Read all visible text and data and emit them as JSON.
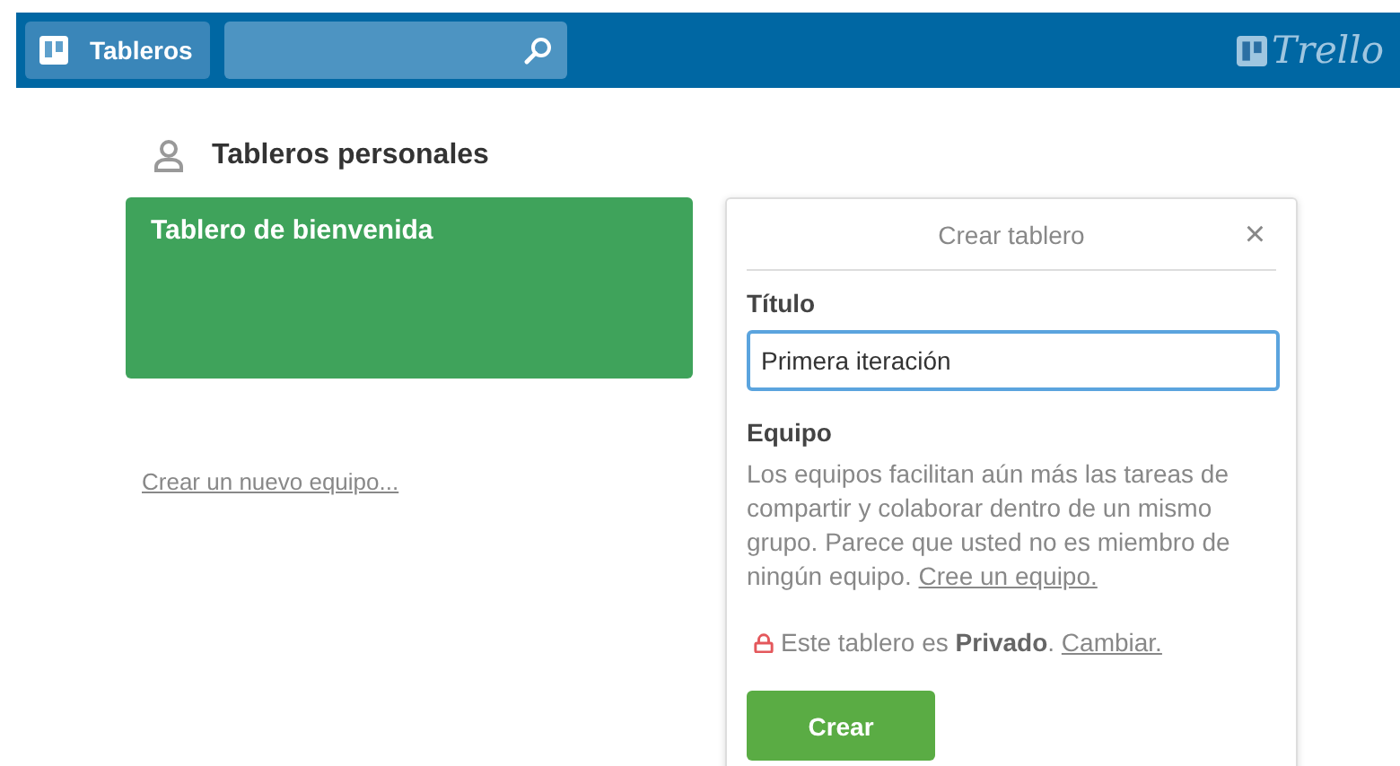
{
  "header": {
    "boards_button": "Tableros",
    "logo": "Trello"
  },
  "section": {
    "title": "Tableros personales"
  },
  "boards": [
    {
      "title": "Tablero de bienvenida",
      "color": "#3fa35b"
    }
  ],
  "create_team_link": "Crear un nuevo equipo...",
  "popover": {
    "title": "Crear tablero",
    "close": "×",
    "title_label": "Título",
    "title_value": "Primera iteración",
    "team_label": "Equipo",
    "team_text": "Los equipos facilitan aún más las tareas de compartir y colaborar dentro de un mismo grupo. Parece que usted no es miembro de ningún equipo.",
    "team_link": "Cree un equipo.",
    "privacy_text": "Este tablero es **Privado**.",
    "privacy_link": "Cambiar.",
    "submit": "Crear"
  }
}
